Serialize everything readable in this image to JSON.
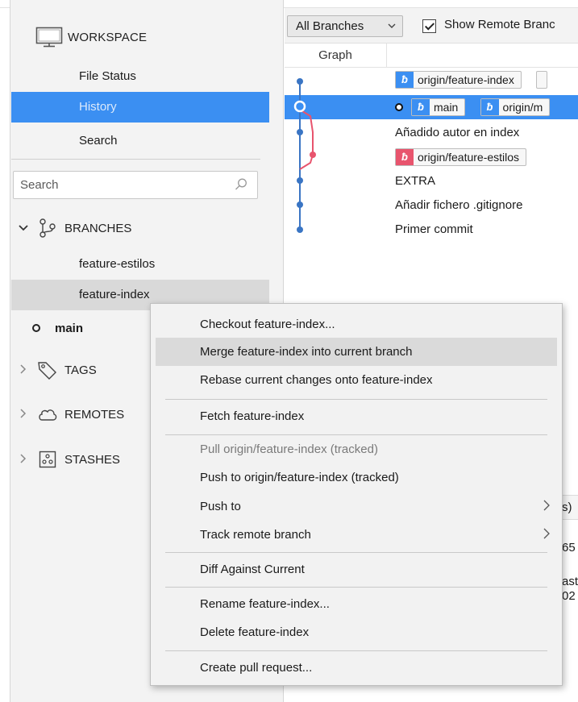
{
  "sidebar": {
    "workspace_label": "WORKSPACE",
    "items": [
      {
        "label": "File Status"
      },
      {
        "label": "History"
      },
      {
        "label": "Search"
      }
    ],
    "search_placeholder": "Search",
    "branches_label": "BRANCHES",
    "branch_items": [
      {
        "label": "feature-estilos"
      },
      {
        "label": "feature-index"
      },
      {
        "label": "main"
      }
    ],
    "tags_label": "TAGS",
    "remotes_label": "REMOTES",
    "stashes_label": "STASHES"
  },
  "toolbar": {
    "branch_filter": "All Branches",
    "show_remote_label": "Show Remote Branc",
    "show_remote_checked": true
  },
  "graph": {
    "column_header": "Graph",
    "commits": [
      {
        "tags": [
          {
            "name": "origin/feature-index",
            "color": "blue"
          }
        ],
        "message": ""
      },
      {
        "tags": [
          {
            "name": "main",
            "color": "blue"
          },
          {
            "name": "origin/m",
            "color": "blue"
          }
        ],
        "message": "",
        "head": true
      },
      {
        "tags": [],
        "message": "Añadido autor en index"
      },
      {
        "tags": [
          {
            "name": "origin/feature-estilos",
            "color": "red"
          }
        ],
        "message": ""
      },
      {
        "tags": [],
        "message": "EXTRA"
      },
      {
        "tags": [],
        "message": "Añadir fichero .gitignore"
      },
      {
        "tags": [],
        "message": "Primer commit"
      }
    ],
    "colors": {
      "blue": "#3a75c4",
      "red": "#e8546d"
    }
  },
  "bottom_panel": {
    "fragments": [
      "s)",
      "65",
      "ast",
      "02"
    ]
  },
  "context_menu": {
    "items": [
      {
        "label": "Checkout feature-index...",
        "enabled": true
      },
      {
        "label": "Merge feature-index into current branch",
        "enabled": true,
        "highlighted": true
      },
      {
        "label": "Rebase current changes onto feature-index",
        "enabled": true
      },
      {
        "label": "Fetch feature-index",
        "enabled": true
      },
      {
        "label": "Pull origin/feature-index (tracked)",
        "enabled": false
      },
      {
        "label": "Push to origin/feature-index (tracked)",
        "enabled": true
      },
      {
        "label": "Push to",
        "enabled": true,
        "submenu": true
      },
      {
        "label": "Track remote branch",
        "enabled": true,
        "submenu": true
      },
      {
        "label": "Diff Against Current",
        "enabled": true
      },
      {
        "label": "Rename feature-index...",
        "enabled": true
      },
      {
        "label": "Delete feature-index",
        "enabled": true
      },
      {
        "label": "Create pull request...",
        "enabled": true
      }
    ]
  },
  "colors": {
    "accent": "#3b8ff2",
    "sidebar_bg": "#f3f3f3",
    "menu_bg": "#f2f2f2",
    "menu_highlight": "#dadada"
  }
}
